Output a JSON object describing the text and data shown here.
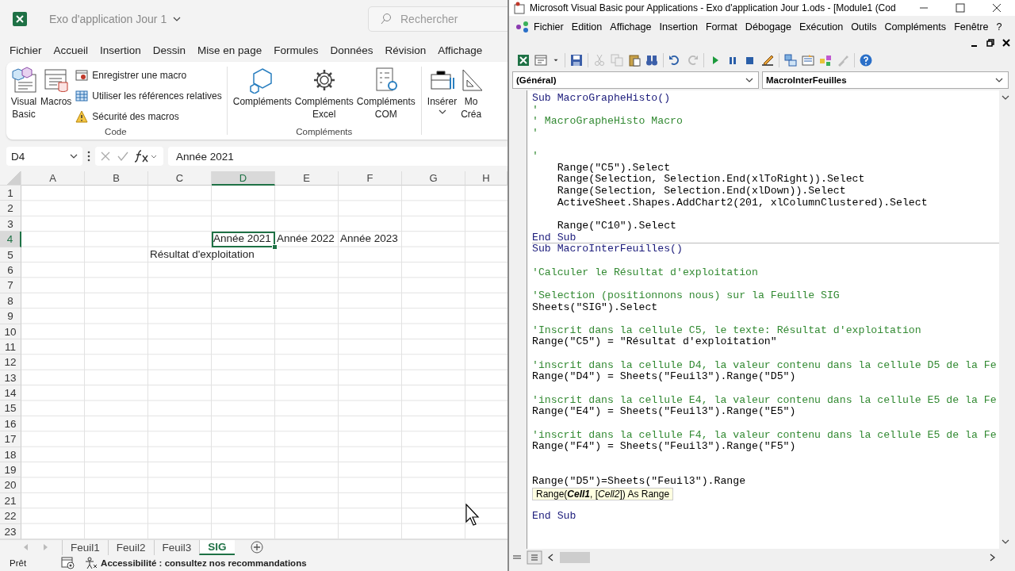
{
  "excel": {
    "title": "Exo d'application Jour 1",
    "search": {
      "placeholder": "Rechercher"
    },
    "tabs": [
      "Fichier",
      "Accueil",
      "Insertion",
      "Dessin",
      "Mise en page",
      "Formules",
      "Données",
      "Révision",
      "Affichage"
    ],
    "ribbon": {
      "groups": [
        {
          "label": "Code",
          "large": [
            {
              "label": "Visual Basic",
              "dropdown": false
            },
            {
              "label": "Macros",
              "dropdown": false
            }
          ],
          "small": [
            "Enregistrer une macro",
            "Utiliser les références relatives",
            "Sécurité des macros"
          ]
        },
        {
          "label": "Compléments",
          "large": [
            {
              "label": "Compléments",
              "dropdown": false
            },
            {
              "label": "Compléments Excel",
              "dropdown": false
            },
            {
              "label": "Compléments COM",
              "dropdown": false
            }
          ]
        },
        {
          "large": [
            {
              "label": "Insérer",
              "dropdown": true
            },
            {
              "label": "Mo Créa",
              "dropdown": false
            }
          ]
        }
      ]
    },
    "name_box": "D4",
    "formula": "Année 2021",
    "columns": [
      {
        "label": "A",
        "selected": false
      },
      {
        "label": "B",
        "selected": false
      },
      {
        "label": "C",
        "selected": false
      },
      {
        "label": "D",
        "selected": true
      },
      {
        "label": "E",
        "selected": false
      },
      {
        "label": "F",
        "selected": false
      },
      {
        "label": "G",
        "selected": false
      },
      {
        "label": "H",
        "selected": false
      }
    ],
    "rows": [
      {
        "label": "1",
        "selected": false
      },
      {
        "label": "2",
        "selected": false
      },
      {
        "label": "3",
        "selected": false
      },
      {
        "label": "4",
        "selected": true,
        "cells": [
          {
            "selected": false
          },
          {
            "selected": false
          },
          {
            "selected": false
          },
          {
            "text": "Année 2021",
            "selected": true
          },
          {
            "text": "Année 2022",
            "selected": false
          },
          {
            "text": "Année 2023",
            "selected": false
          },
          {
            "selected": false
          },
          {
            "selected": false
          }
        ]
      },
      {
        "label": "5",
        "selected": false,
        "cells": [
          {
            "selected": false
          },
          {
            "selected": false
          },
          {
            "text": "Résultat d'exploitation",
            "selected": false
          },
          {
            "selected": false
          },
          {
            "selected": false
          },
          {
            "selected": false
          },
          {
            "selected": false
          },
          {
            "selected": false
          }
        ]
      },
      {
        "label": "6",
        "selected": false
      },
      {
        "label": "7",
        "selected": false
      },
      {
        "label": "8",
        "selected": false
      },
      {
        "label": "9",
        "selected": false
      },
      {
        "label": "10",
        "selected": false
      },
      {
        "label": "11",
        "selected": false
      },
      {
        "label": "12",
        "selected": false
      },
      {
        "label": "13",
        "selected": false
      },
      {
        "label": "14",
        "selected": false
      },
      {
        "label": "15",
        "selected": false
      },
      {
        "label": "16",
        "selected": false
      },
      {
        "label": "17",
        "selected": false
      },
      {
        "label": "18",
        "selected": false
      },
      {
        "label": "19",
        "selected": false
      },
      {
        "label": "20",
        "selected": false
      },
      {
        "label": "21",
        "selected": false
      },
      {
        "label": "22",
        "selected": false
      },
      {
        "label": "23",
        "selected": false
      }
    ],
    "sheets": [
      {
        "label": "Feuil1",
        "selected": false
      },
      {
        "label": "Feuil2",
        "selected": false
      },
      {
        "label": "Feuil3",
        "selected": false
      },
      {
        "label": "SIG",
        "selected": true
      }
    ],
    "status": {
      "mode": "Prêt",
      "accessibility": "Accessibilité : consultez nos recommandations"
    }
  },
  "vba": {
    "title": "Microsoft Visual Basic pour Applications - Exo d'application Jour 1.ods - [Module1 (Cod",
    "menu": [
      "Fichier",
      "Edition",
      "Affichage",
      "Insertion",
      "Format",
      "Débogage",
      "Exécution",
      "Outils",
      "Compléments",
      "Fenêtre",
      "?"
    ],
    "object_combo": "(Général)",
    "procedure_combo": "MacroInterFeuilles",
    "procedures": [
      {
        "lines": [
          {
            "kind": "keyword",
            "text": "Sub MacroGrapheHisto()"
          },
          {
            "kind": "comment",
            "text": "'"
          },
          {
            "kind": "comment",
            "text": "' MacroGrapheHisto Macro"
          },
          {
            "kind": "comment",
            "text": "'"
          },
          {
            "kind": "blank"
          },
          {
            "kind": "comment",
            "text": "'"
          },
          {
            "kind": "code",
            "text": "    Range(\"C5\").Select"
          },
          {
            "kind": "code",
            "text": "    Range(Selection, Selection.End(xlToRight)).Select"
          },
          {
            "kind": "code",
            "text": "    Range(Selection, Selection.End(xlDown)).Select"
          },
          {
            "kind": "code",
            "text": "    ActiveSheet.Shapes.AddChart2(201, xlColumnClustered).Select"
          },
          {
            "kind": "blank"
          },
          {
            "kind": "code",
            "text": "    Range(\"C10\").Select"
          },
          {
            "kind": "keyword",
            "text": "End Sub"
          }
        ]
      },
      {
        "lines": [
          {
            "kind": "keyword",
            "text": "Sub MacroInterFeuilles()"
          },
          {
            "kind": "blank"
          },
          {
            "kind": "comment",
            "text": "'Calculer le Résultat d'exploitation"
          },
          {
            "kind": "blank"
          },
          {
            "kind": "comment",
            "text": "'Selection (positionnons nous) sur la Feuille SIG"
          },
          {
            "kind": "code",
            "text": "Sheets(\"SIG\").Select"
          },
          {
            "kind": "blank"
          },
          {
            "kind": "comment",
            "text": "'Inscrit dans la cellule C5, le texte: Résultat d'exploitation"
          },
          {
            "kind": "code",
            "text": "Range(\"C5\") = \"Résultat d'exploitation\""
          },
          {
            "kind": "blank"
          },
          {
            "kind": "comment",
            "text": "'inscrit dans la cellule D4, la valeur contenu dans la cellule D5 de la Fe"
          },
          {
            "kind": "code",
            "text": "Range(\"D4\") = Sheets(\"Feuil3\").Range(\"D5\")"
          },
          {
            "kind": "blank"
          },
          {
            "kind": "comment",
            "text": "'inscrit dans la cellule E4, la valeur contenu dans la cellule E5 de la Fe"
          },
          {
            "kind": "code",
            "text": "Range(\"E4\") = Sheets(\"Feuil3\").Range(\"E5\")"
          },
          {
            "kind": "blank"
          },
          {
            "kind": "comment",
            "text": "'inscrit dans la cellule F4, la valeur contenu dans la cellule E5 de la Fe"
          },
          {
            "kind": "code",
            "text": "Range(\"F4\") = Sheets(\"Feuil3\").Range(\"F5\")"
          },
          {
            "kind": "blank"
          },
          {
            "kind": "blank"
          },
          {
            "kind": "code",
            "text": "Range(\"D5\")=Sheets(\"Feuil3\").Range"
          },
          {
            "kind": "tooltip",
            "text": "Range(**Cell1**, [*Cell2*]) As Range"
          },
          {
            "kind": "blank"
          },
          {
            "kind": "keyword",
            "text": "End Sub"
          }
        ]
      }
    ]
  }
}
